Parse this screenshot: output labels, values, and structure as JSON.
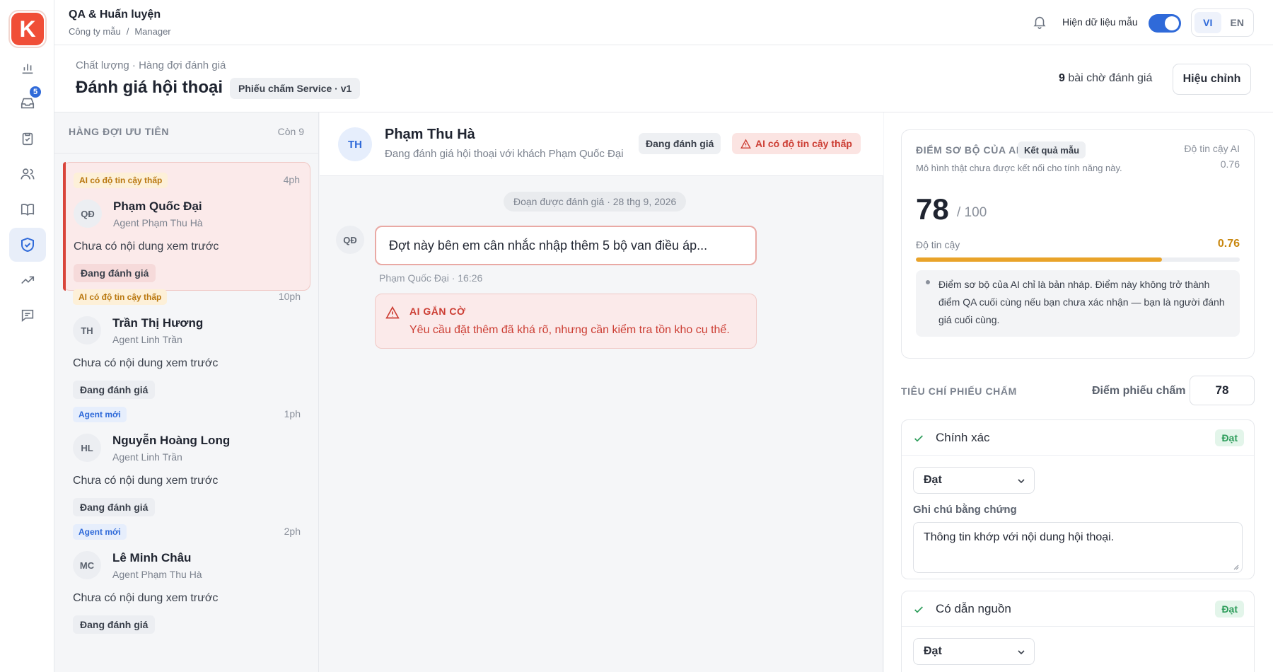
{
  "brand": {
    "logo_letter": "K",
    "accent": "#2f6ad9",
    "logo_color": "#f04e37"
  },
  "rail": {
    "items": [
      {
        "icon": "bar-chart-icon"
      },
      {
        "icon": "inbox-icon",
        "badge": "5"
      },
      {
        "icon": "clipboard-check-icon"
      },
      {
        "icon": "users-icon"
      },
      {
        "icon": "book-icon"
      },
      {
        "icon": "shield-check-icon",
        "active": true
      },
      {
        "icon": "trending-up-icon"
      },
      {
        "icon": "message-icon"
      }
    ]
  },
  "topbar": {
    "title": "QA & Huấn luyện",
    "crumb_company": "Công ty mẫu",
    "crumb_sep": "/",
    "crumb_role": "Manager",
    "sample_label": "Hiện dữ liệu mẫu",
    "sample_on": true,
    "lang_vi": "VI",
    "lang_en": "EN"
  },
  "page": {
    "crumb": "Chất lượng · Hàng đợi đánh giá",
    "title": "Đánh giá hội thoại",
    "scorecard_chip": "Phiếu chấm Service · v1",
    "pending_count": "9",
    "pending_text": "bài chờ đánh giá",
    "edit_button": "Hiệu chỉnh"
  },
  "queue": {
    "header": "HÀNG ĐỢI ƯU TIÊN",
    "remaining": "Còn 9",
    "items": [
      {
        "tag": "AI có độ tin cậy thấp",
        "tag_type": "warn",
        "time": "4ph",
        "initials": "QĐ",
        "name": "Phạm Quốc Đại",
        "agent": "Agent Phạm Thu Hà",
        "preview": "Chưa có nội dung xem trước",
        "status": "Đang đánh giá"
      },
      {
        "tag": "AI có độ tin cậy thấp",
        "tag_type": "warn",
        "time": "10ph",
        "initials": "TH",
        "name": "Trần Thị Hương",
        "agent": "Agent Linh Trần",
        "preview": "Chưa có nội dung xem trước",
        "status": "Đang đánh giá"
      },
      {
        "tag": "Agent mới",
        "tag_type": "new",
        "time": "1ph",
        "initials": "HL",
        "name": "Nguyễn Hoàng Long",
        "agent": "Agent Linh Trần",
        "preview": "Chưa có nội dung xem trước",
        "status": "Đang đánh giá"
      },
      {
        "tag": "Agent mới",
        "tag_type": "new",
        "time": "2ph",
        "initials": "MC",
        "name": "Lê Minh Châu",
        "agent": "Agent Phạm Thu Hà",
        "preview": "Chưa có nội dung xem trước",
        "status": "Đang đánh giá"
      }
    ]
  },
  "conversation": {
    "initials": "TH",
    "name": "Phạm Thu Hà",
    "subtitle": "Đang đánh giá hội thoại với khách Phạm Quốc Đại",
    "status_chip": "Đang đánh giá",
    "alert_chip": "AI có độ tin cậy thấp",
    "segment": "Đoạn được đánh giá · 28 thg 9, 2026",
    "message": {
      "initials": "QĐ",
      "text": "Đợt này bên em cân nhắc nhập thêm 5 bộ van điều áp...",
      "meta": "Phạm Quốc Đại · 16:26"
    },
    "flag": {
      "title": "AI GẮN CỜ",
      "text": "Yêu cầu đặt thêm đã khá rõ, nhưng cần kiểm tra tồn kho cụ thể."
    }
  },
  "ai_score": {
    "title": "ĐIỂM SƠ BỘ CỦA AI",
    "chip": "Kết quả mẫu",
    "confidence_label": "Độ tin cậy AI",
    "confidence_value": "0.76",
    "description": "Mô hình thật chưa được kết nối cho tính năng này.",
    "score": "78",
    "max": "/ 100",
    "bar_label": "Độ tin cậy",
    "bar_value": "0.76",
    "bar_fraction": 0.76,
    "note": "Điểm sơ bộ của AI chỉ là bản nháp. Điểm này không trở thành điểm QA cuối cùng nếu bạn chưa xác nhận — bạn là người đánh giá cuối cùng."
  },
  "criteria": {
    "header": "TIÊU CHÍ PHIẾU CHẤM",
    "score_label": "Điểm phiếu chấm",
    "score_value": "78",
    "items": [
      {
        "name": "Chính xác",
        "result": "Đạt",
        "select_value": "Đạt",
        "evidence_label": "Ghi chú bằng chứng",
        "evidence": "Thông tin khớp với nội dung hội thoại."
      },
      {
        "name": "Có dẫn nguồn",
        "result": "Đạt",
        "select_value": "Đạt"
      }
    ]
  }
}
